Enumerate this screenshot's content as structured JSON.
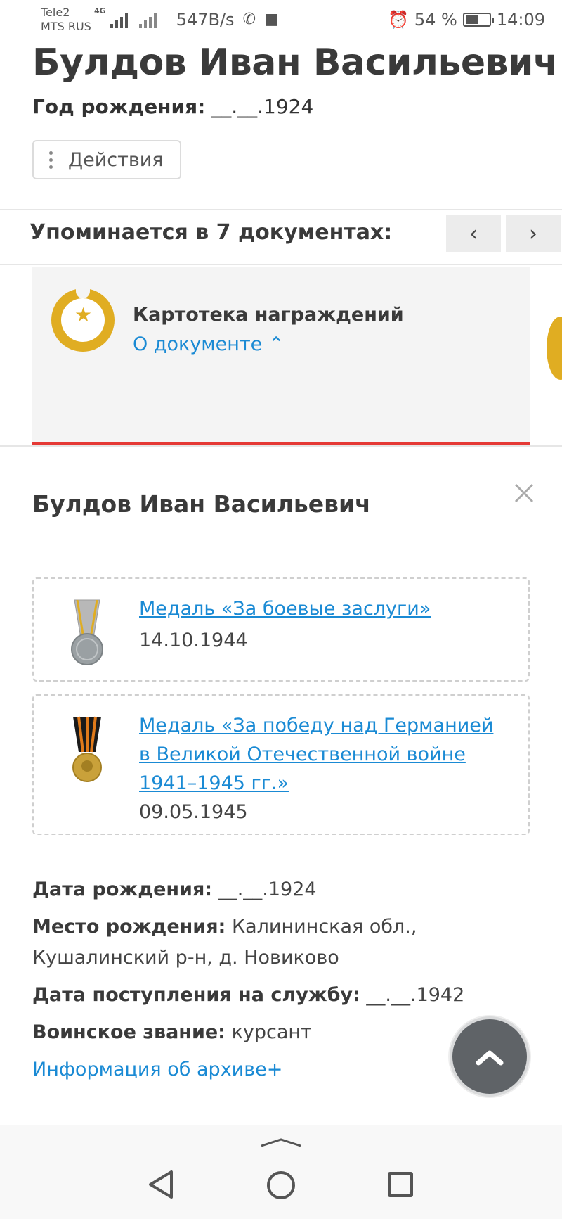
{
  "status_bar": {
    "carrier_1": "Tele2",
    "carrier_2": "MTS RUS",
    "network_tag": "4G",
    "speed": "547B/s",
    "battery_text": "54 %",
    "battery_level": 0.54,
    "time": "14:09"
  },
  "person": {
    "name": "Булдов Иван Васильевич",
    "birth_year_label": "Год рождения:",
    "birth_year_value": " __.__.1924",
    "actions_label": "Действия"
  },
  "documents": {
    "mentions_title": "Упоминается в 7 документах:",
    "prev_glyph": "‹",
    "next_glyph": "›",
    "card": {
      "title": "Картотека награждений",
      "link": "О документе ⌃"
    }
  },
  "detail": {
    "name": "Булдов Иван Васильевич",
    "awards": [
      {
        "title": "Медаль «За боевые заслуги»",
        "date": "14.10.1944",
        "icon": "medal-combat-merit-icon"
      },
      {
        "title": "Медаль «За победу над Германией в Великой Отечественной войне 1941–1945 гг.»",
        "date": "09.05.1945",
        "icon": "medal-victory-germany-icon"
      }
    ],
    "facts": {
      "birth_date_label": "Дата рождения:",
      "birth_date_value": " __.__.1924",
      "birth_place_label": "Место рождения:",
      "birth_place_value": " Калининская обл., Кушалинский р-н, д. Новиково",
      "service_start_label": "Дата поступления на службу:",
      "service_start_value": " __.__.1942",
      "rank_label": "Воинское звание:",
      "rank_value": " курсант"
    },
    "archive_link": "Информация об архиве+"
  },
  "colors": {
    "accent_link": "#1a8ad4",
    "gold": "#e0ad22",
    "red_bar": "#e53935"
  }
}
